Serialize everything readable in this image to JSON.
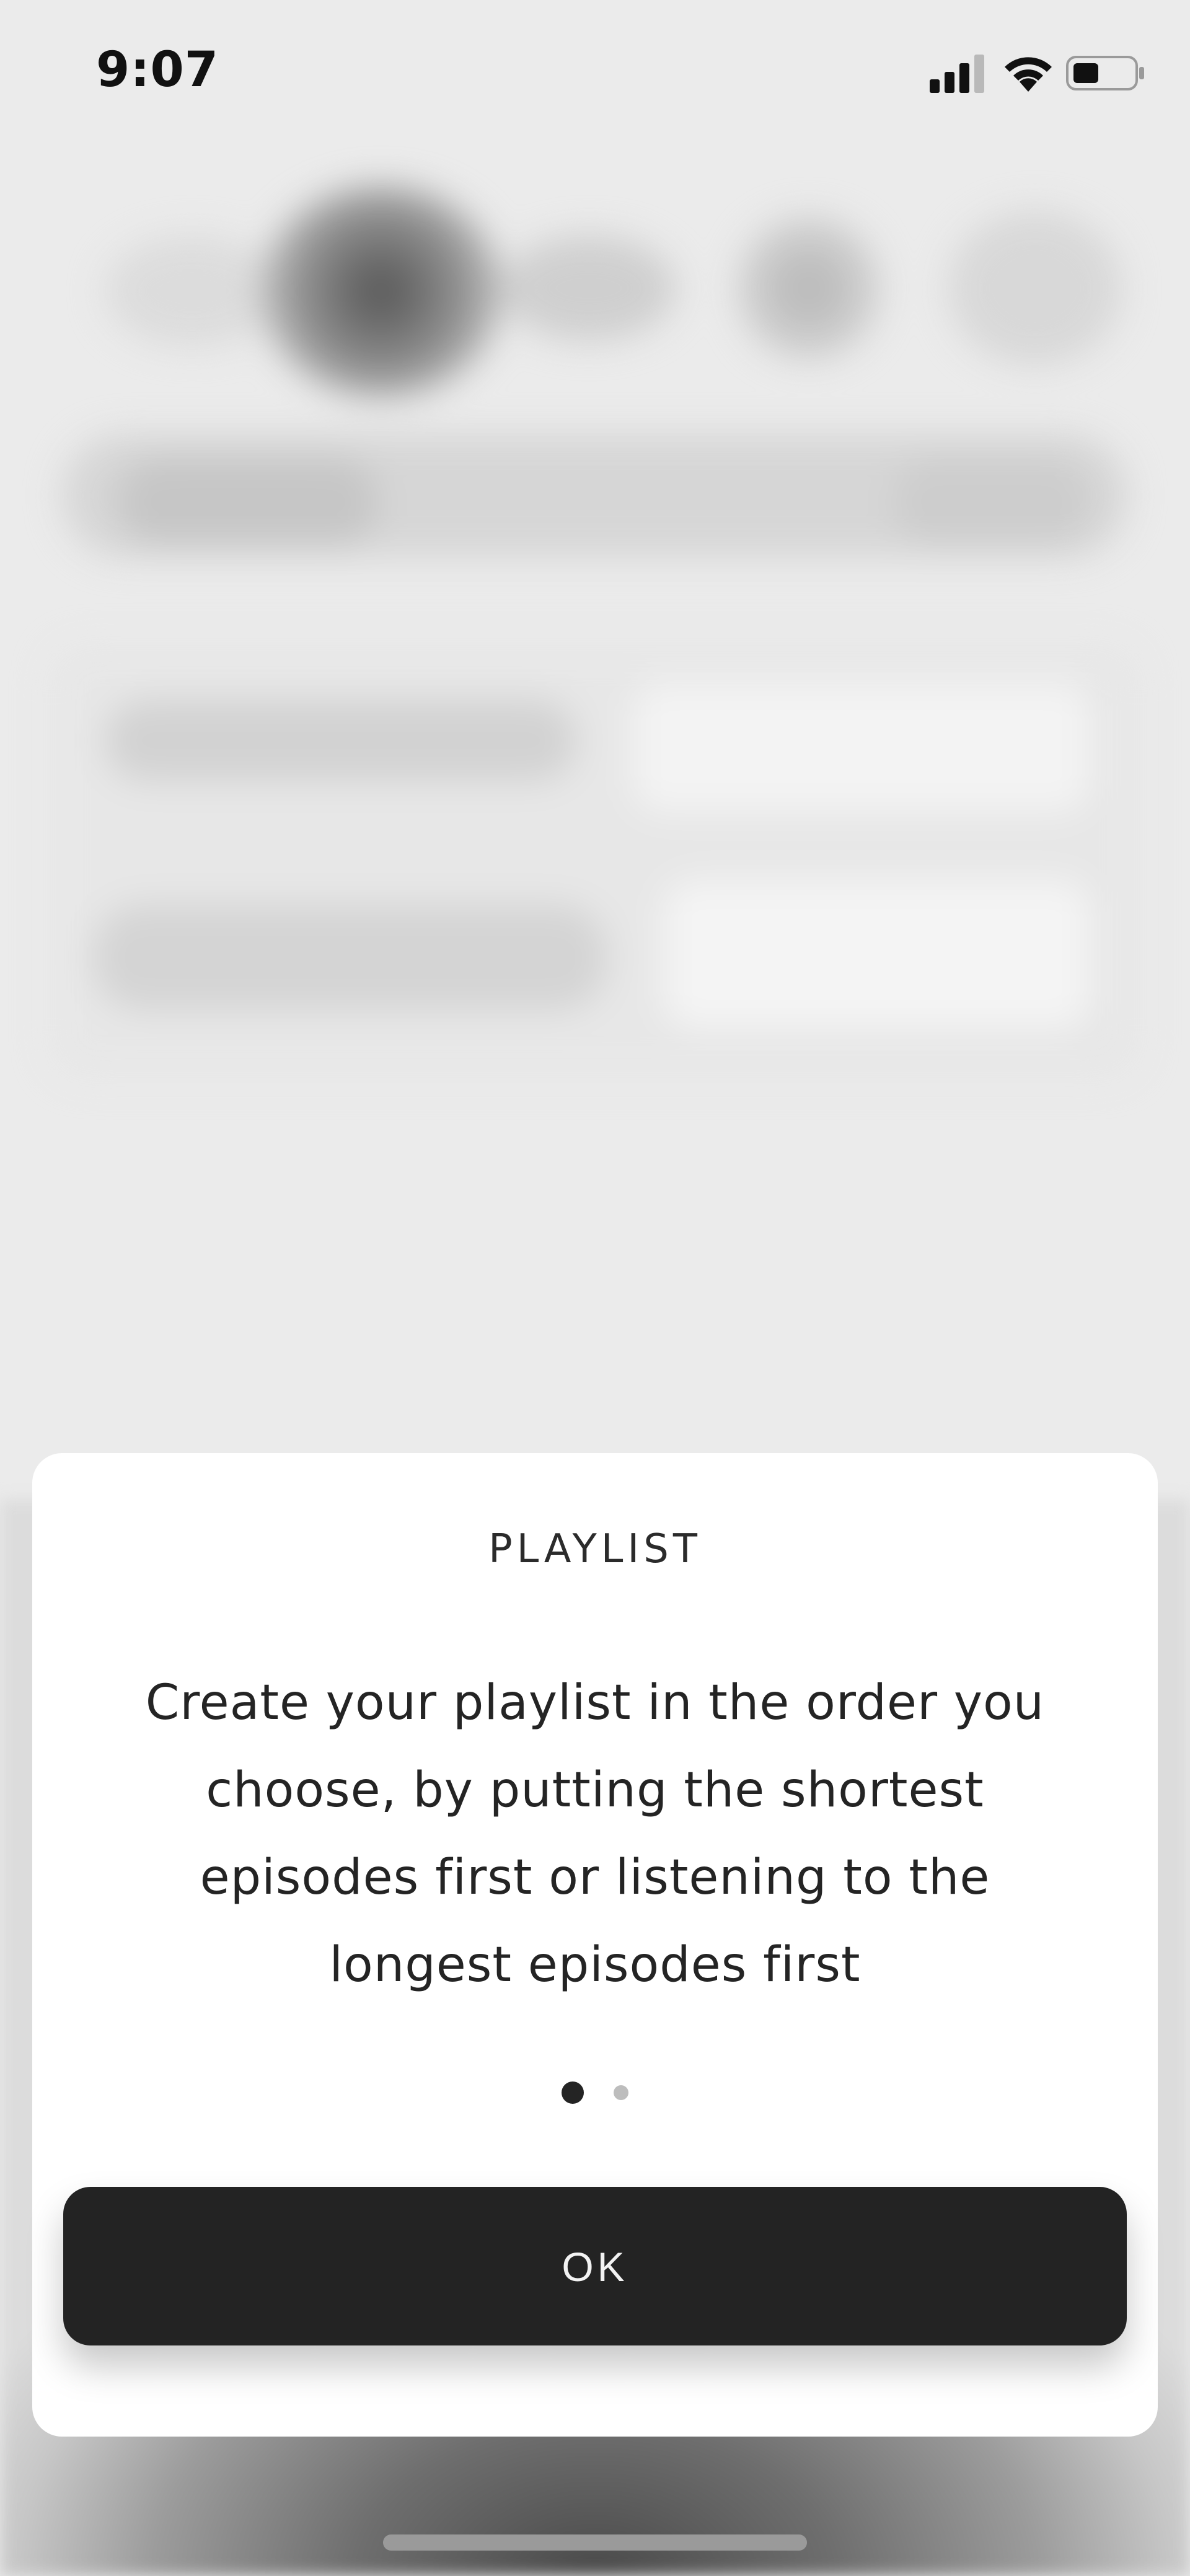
{
  "status_bar": {
    "time": "9:07"
  },
  "sheet": {
    "title": "PLAYLIST",
    "body": "Create your playlist in the order you choose, by putting the shortest episodes first or listening to the longest episodes first",
    "pager": {
      "total": 2,
      "active_index": 0
    },
    "ok_label": "OK"
  },
  "colors": {
    "button_bg": "#232323",
    "sheet_bg": "#ffffff",
    "text": "#242424"
  }
}
